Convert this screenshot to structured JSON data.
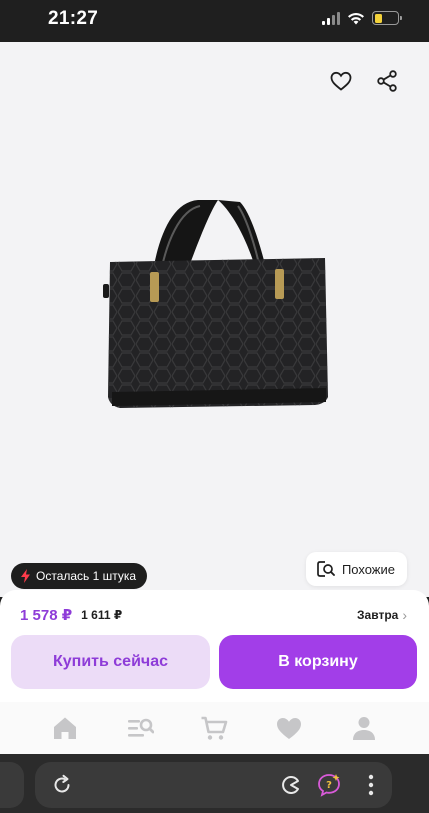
{
  "status_bar": {
    "time": "21:27"
  },
  "product": {
    "stock_badge": "Осталась 1 штука",
    "similar_label": "Похожие"
  },
  "purchase": {
    "price": "1 578 ₽",
    "old_price": "1 611 ₽",
    "delivery": "Завтра",
    "buy_now_label": "Купить сейчас",
    "add_to_cart_label": "В корзину"
  },
  "tab_bar": {
    "items": [
      "home-icon",
      "catalog-search-icon",
      "cart-icon",
      "favorites-icon",
      "profile-icon"
    ]
  },
  "colors": {
    "accent": "#a23ee8",
    "price": "#8e3cd8",
    "buy_now_bg": "#ecdcf7"
  }
}
